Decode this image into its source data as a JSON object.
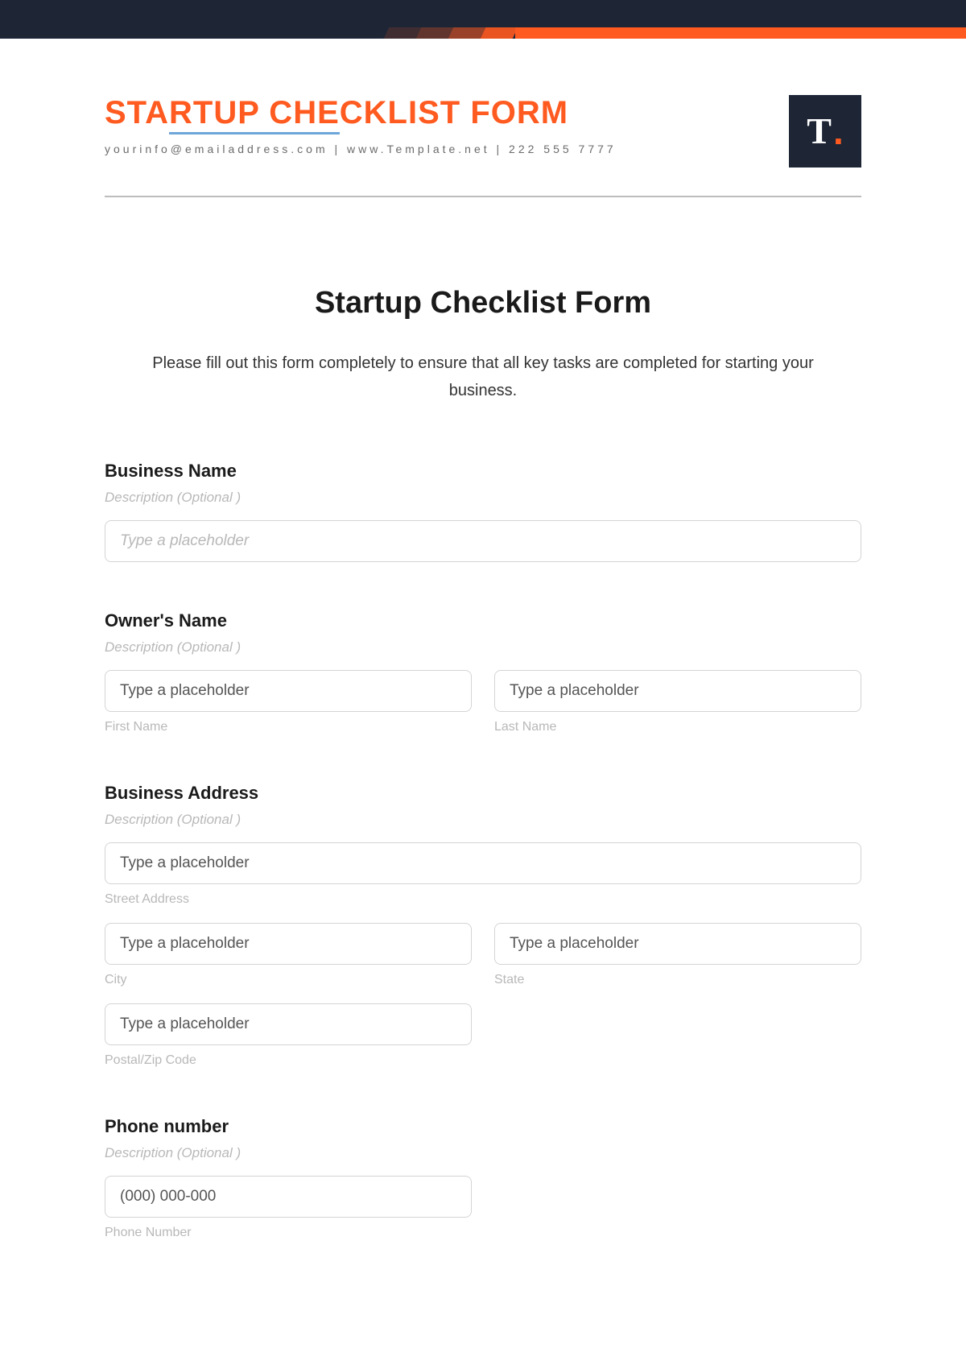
{
  "brand": {
    "title_prefix": "STA",
    "title_underlined": "RTUP CHE",
    "title_suffix": "CKLIST FORM",
    "contact": "yourinfo@emailaddress.com | www.Template.net | 222 555 7777",
    "logo_letter": "T",
    "logo_dot": "."
  },
  "form": {
    "title": "Startup Checklist Form",
    "intro": "Please fill out this form completely to ensure that all key tasks are completed for starting your business."
  },
  "fields": {
    "business_name": {
      "label": "Business Name",
      "desc": "Description (Optional )",
      "placeholder": "Type a placeholder"
    },
    "owner": {
      "label": "Owner's Name",
      "desc": "Description (Optional )",
      "first_placeholder": "Type a placeholder",
      "first_sublabel": "First Name",
      "last_placeholder": "Type a placeholder",
      "last_sublabel": "Last Name"
    },
    "address": {
      "label": "Business Address",
      "desc": "Description (Optional )",
      "street_placeholder": "Type a placeholder",
      "street_sublabel": "Street Address",
      "city_placeholder": "Type a placeholder",
      "city_sublabel": "City",
      "state_placeholder": "Type a placeholder",
      "state_sublabel": "State",
      "zip_placeholder": "Type a placeholder",
      "zip_sublabel": "Postal/Zip Code"
    },
    "phone": {
      "label": "Phone number",
      "desc": "Description (Optional )",
      "placeholder": "(000) 000-000",
      "sublabel": "Phone Number"
    }
  }
}
